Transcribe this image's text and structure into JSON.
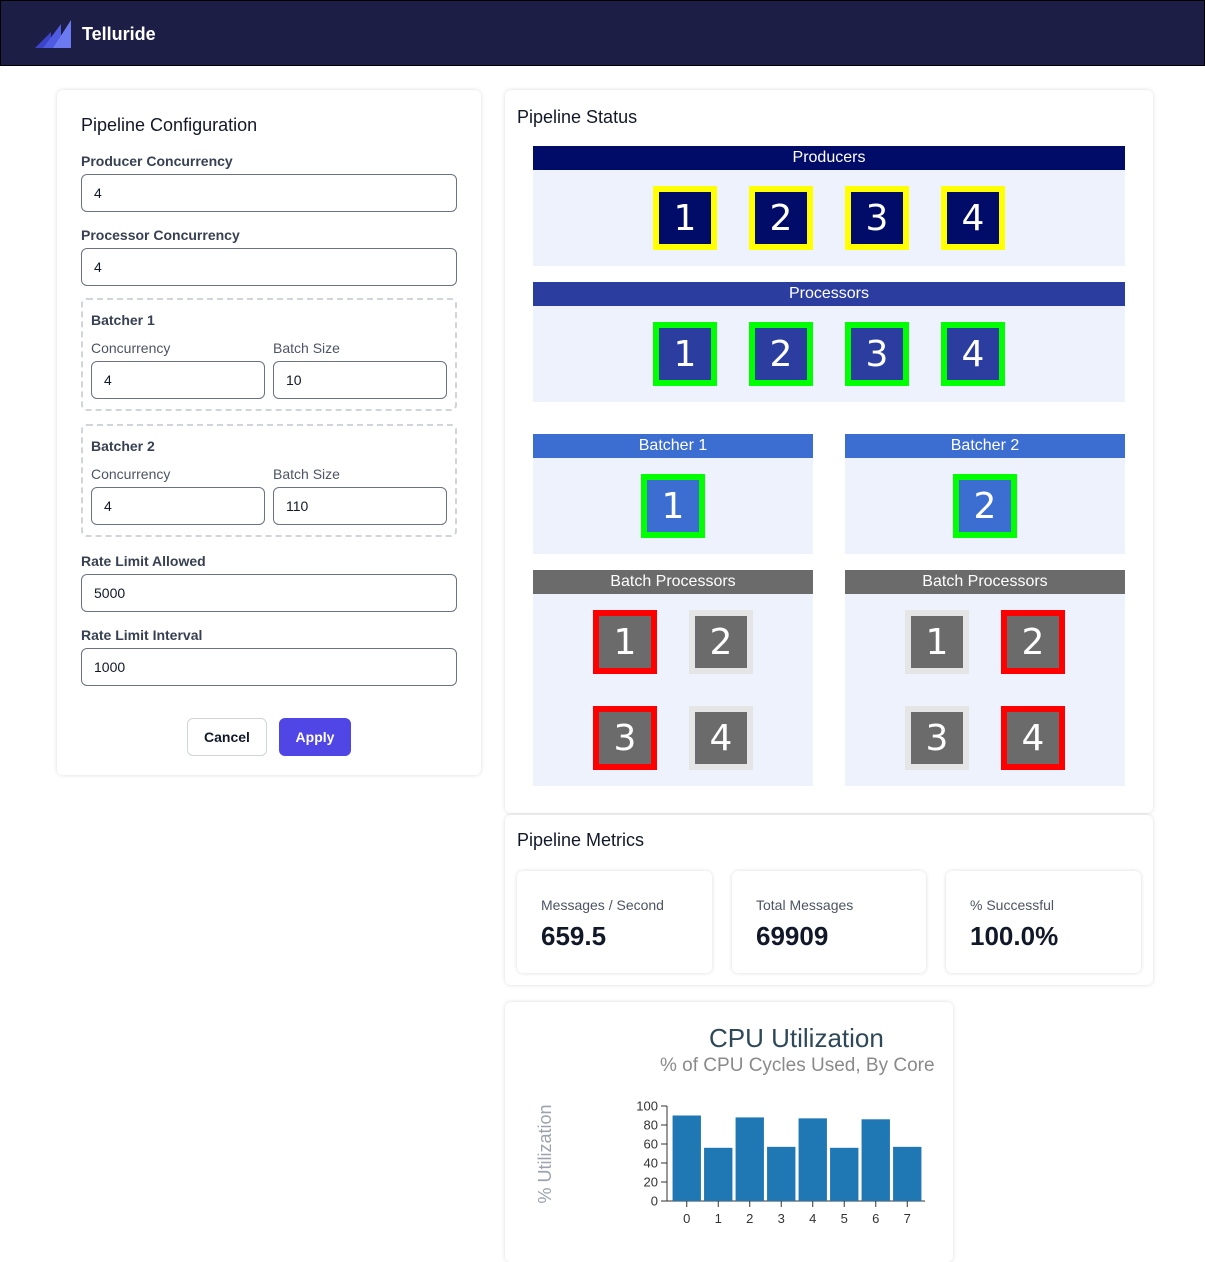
{
  "app": {
    "brand": "Telluride"
  },
  "config": {
    "title": "Pipeline Configuration",
    "producer_concurrency": {
      "label": "Producer Concurrency",
      "value": "4"
    },
    "processor_concurrency": {
      "label": "Processor Concurrency",
      "value": "4"
    },
    "batchers": [
      {
        "title": "Batcher 1",
        "concurrency_label": "Concurrency",
        "concurrency": "4",
        "batch_size_label": "Batch Size",
        "batch_size": "10"
      },
      {
        "title": "Batcher 2",
        "concurrency_label": "Concurrency",
        "concurrency": "4",
        "batch_size_label": "Batch Size",
        "batch_size": "110"
      }
    ],
    "rate_limit_allowed": {
      "label": "Rate Limit Allowed",
      "value": "5000"
    },
    "rate_limit_interval": {
      "label": "Rate Limit Interval",
      "value": "1000"
    },
    "cancel_label": "Cancel",
    "apply_label": "Apply"
  },
  "status": {
    "title": "Pipeline Status",
    "producers": {
      "label": "Producers",
      "workers": [
        "1",
        "2",
        "3",
        "4"
      ]
    },
    "processors": {
      "label": "Processors",
      "workers": [
        "1",
        "2",
        "3",
        "4"
      ]
    },
    "batchers": [
      {
        "label": "Batcher 1",
        "worker": "1"
      },
      {
        "label": "Batcher 2",
        "worker": "2"
      }
    ],
    "batch_processors": [
      {
        "label": "Batch Processors",
        "workers": [
          "1",
          "2",
          "3",
          "4"
        ],
        "busy": [
          true,
          false,
          true,
          false
        ]
      },
      {
        "label": "Batch Processors",
        "workers": [
          "1",
          "2",
          "3",
          "4"
        ],
        "busy": [
          false,
          true,
          false,
          true
        ]
      }
    ],
    "colors": {
      "producer_header": "#000c67",
      "processor_header": "#2c3da0",
      "batcher_header": "#3c6dd0",
      "batch_processor_header": "#6b6b6b",
      "active_border_producer": "#ffff00",
      "active_border": "#00ff00",
      "busy_border": "#ff0000",
      "idle_border": "#e5e5e5"
    }
  },
  "metrics": {
    "title": "Pipeline Metrics",
    "items": [
      {
        "label": "Messages / Second",
        "value": "659.5"
      },
      {
        "label": "Total Messages",
        "value": "69909"
      },
      {
        "label": "% Successful",
        "value": "100.0%"
      }
    ]
  },
  "chart_data": {
    "type": "bar",
    "title": "CPU Utilization",
    "subtitle": "% of CPU Cycles Used, By Core",
    "xlabel": "",
    "ylabel": "% Utilization",
    "categories": [
      "0",
      "1",
      "2",
      "3",
      "4",
      "5",
      "6",
      "7"
    ],
    "values": [
      90,
      56,
      88,
      57,
      87,
      56,
      86,
      57
    ],
    "ylim": [
      0,
      100
    ],
    "yticks": [
      "0",
      "20",
      "40",
      "60",
      "80",
      "100"
    ],
    "bar_color": "#1f77b4",
    "grid": false,
    "legend": "none"
  }
}
